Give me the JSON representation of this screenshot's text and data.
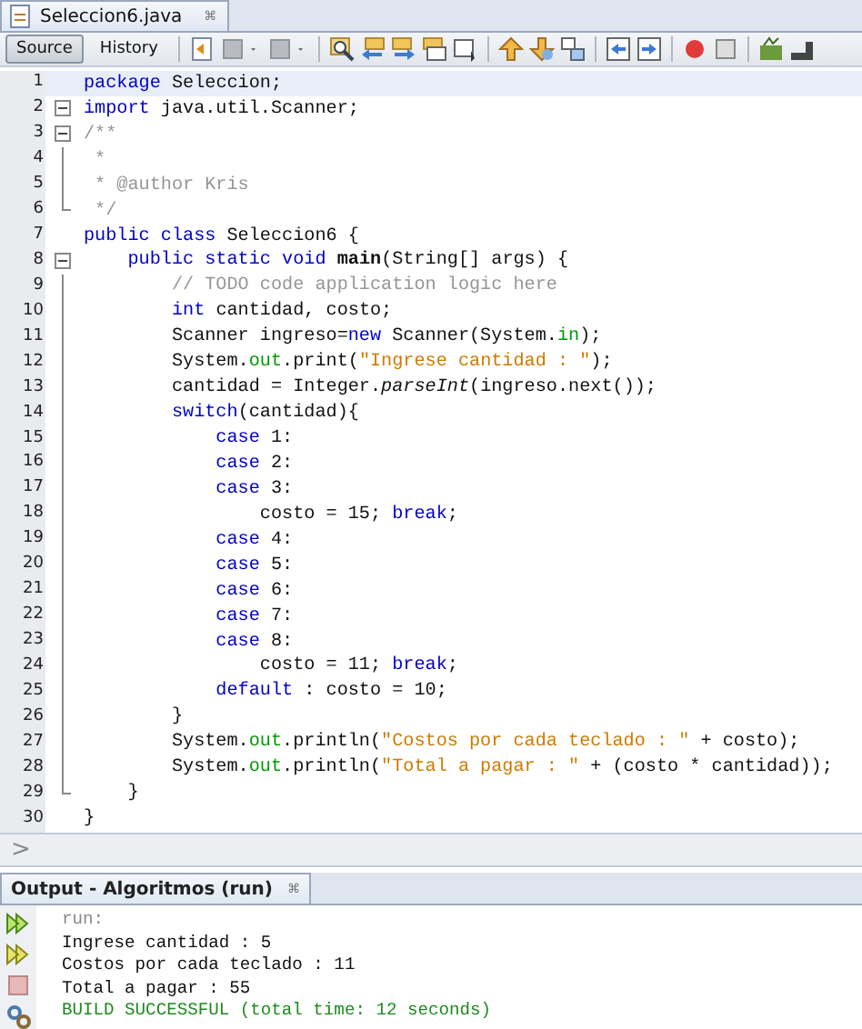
{
  "editor_tab": {
    "title": "Seleccion6.java",
    "close": "⌘"
  },
  "view_tabs": [
    {
      "label": "Source",
      "selected": true
    },
    {
      "label": "History",
      "selected": false
    }
  ],
  "code_lines": [
    {
      "number": "1",
      "current": true,
      "tokens": [
        {
          "t": "package",
          "kind": "kw"
        },
        {
          "t": " Seleccion;",
          "kind": "plain"
        }
      ]
    },
    {
      "number": "2",
      "current": false,
      "fold": {
        "kind": "start"
      },
      "tokens": [
        {
          "t": "import",
          "kind": "kw"
        },
        {
          "t": " java.util.Scanner;",
          "kind": "plain"
        }
      ]
    },
    {
      "number": "3",
      "current": false,
      "fold": {
        "kind": "start"
      },
      "tokens": [
        {
          "t": "/**",
          "kind": "comment"
        }
      ]
    },
    {
      "number": "4",
      "current": false,
      "fold": {
        "kind": "line"
      },
      "tokens": [
        {
          "t": " *",
          "kind": "comment"
        }
      ]
    },
    {
      "number": "5",
      "current": false,
      "fold": {
        "kind": "line"
      },
      "tokens": [
        {
          "t": " * @author Kris",
          "kind": "comment"
        }
      ]
    },
    {
      "number": "6",
      "current": false,
      "fold": {
        "kind": "end"
      },
      "tokens": [
        {
          "t": " */",
          "kind": "comment"
        }
      ]
    },
    {
      "number": "7",
      "current": false,
      "tokens": [
        {
          "t": "public class",
          "kind": "kw"
        },
        {
          "t": " Seleccion6 {",
          "kind": "plain"
        }
      ]
    },
    {
      "number": "8",
      "current": false,
      "fold": {
        "kind": "start"
      },
      "tokens": [
        {
          "t": "    public static void ",
          "kind": "kw"
        },
        {
          "t": "main",
          "kind": "method"
        },
        {
          "t": "(String[] args) {",
          "kind": "plain"
        }
      ]
    },
    {
      "number": "9",
      "current": false,
      "fold": {
        "kind": "line"
      },
      "tokens": [
        {
          "t": "        // TODO code application logic here",
          "kind": "comment"
        }
      ]
    },
    {
      "number": "10",
      "current": false,
      "fold": {
        "kind": "line"
      },
      "tokens": [
        {
          "t": "        int",
          "kind": "kw"
        },
        {
          "t": " cantidad, costo;",
          "kind": "plain"
        }
      ]
    },
    {
      "number": "11",
      "current": false,
      "fold": {
        "kind": "line"
      },
      "tokens": [
        {
          "t": "        Scanner ingreso=",
          "kind": "plain"
        },
        {
          "t": "new",
          "kind": "kw"
        },
        {
          "t": " Scanner(System.",
          "kind": "plain"
        },
        {
          "t": "in",
          "kind": "field"
        },
        {
          "t": ");",
          "kind": "plain"
        }
      ]
    },
    {
      "number": "12",
      "current": false,
      "fold": {
        "kind": "line"
      },
      "tokens": [
        {
          "t": "        System.",
          "kind": "plain"
        },
        {
          "t": "out",
          "kind": "field"
        },
        {
          "t": ".print(",
          "kind": "plain"
        },
        {
          "t": "\"Ingrese cantidad : \"",
          "kind": "str"
        },
        {
          "t": ");",
          "kind": "plain"
        }
      ]
    },
    {
      "number": "13",
      "current": false,
      "fold": {
        "kind": "line"
      },
      "tokens": [
        {
          "t": "        cantidad = Integer.",
          "kind": "plain"
        },
        {
          "t": "parseInt",
          "kind": "static"
        },
        {
          "t": "(ingreso.next());",
          "kind": "plain"
        }
      ]
    },
    {
      "number": "14",
      "current": false,
      "fold": {
        "kind": "line"
      },
      "tokens": [
        {
          "t": "        switch",
          "kind": "kw"
        },
        {
          "t": "(cantidad){",
          "kind": "plain"
        }
      ]
    },
    {
      "number": "15",
      "current": false,
      "fold": {
        "kind": "line"
      },
      "tokens": [
        {
          "t": "            case",
          "kind": "kw"
        },
        {
          "t": " 1:",
          "kind": "plain"
        }
      ]
    },
    {
      "number": "16",
      "current": false,
      "fold": {
        "kind": "line"
      },
      "tokens": [
        {
          "t": "            case",
          "kind": "kw"
        },
        {
          "t": " 2:",
          "kind": "plain"
        }
      ]
    },
    {
      "number": "17",
      "current": false,
      "fold": {
        "kind": "line"
      },
      "tokens": [
        {
          "t": "            case",
          "kind": "kw"
        },
        {
          "t": " 3:",
          "kind": "plain"
        }
      ]
    },
    {
      "number": "18",
      "current": false,
      "fold": {
        "kind": "line"
      },
      "tokens": [
        {
          "t": "                costo = 15; ",
          "kind": "plain"
        },
        {
          "t": "break",
          "kind": "kw"
        },
        {
          "t": ";",
          "kind": "plain"
        }
      ]
    },
    {
      "number": "19",
      "current": false,
      "fold": {
        "kind": "line"
      },
      "tokens": [
        {
          "t": "            case",
          "kind": "kw"
        },
        {
          "t": " 4:",
          "kind": "plain"
        }
      ]
    },
    {
      "number": "20",
      "current": false,
      "fold": {
        "kind": "line"
      },
      "tokens": [
        {
          "t": "            case",
          "kind": "kw"
        },
        {
          "t": " 5:",
          "kind": "plain"
        }
      ]
    },
    {
      "number": "21",
      "current": false,
      "fold": {
        "kind": "line"
      },
      "tokens": [
        {
          "t": "            case",
          "kind": "kw"
        },
        {
          "t": " 6:",
          "kind": "plain"
        }
      ]
    },
    {
      "number": "22",
      "current": false,
      "fold": {
        "kind": "line"
      },
      "tokens": [
        {
          "t": "            case",
          "kind": "kw"
        },
        {
          "t": " 7:",
          "kind": "plain"
        }
      ]
    },
    {
      "number": "23",
      "current": false,
      "fold": {
        "kind": "line"
      },
      "tokens": [
        {
          "t": "            case",
          "kind": "kw"
        },
        {
          "t": " 8:",
          "kind": "plain"
        }
      ]
    },
    {
      "number": "24",
      "current": false,
      "fold": {
        "kind": "line"
      },
      "tokens": [
        {
          "t": "                costo = 11; ",
          "kind": "plain"
        },
        {
          "t": "break",
          "kind": "kw"
        },
        {
          "t": ";",
          "kind": "plain"
        }
      ]
    },
    {
      "number": "25",
      "current": false,
      "fold": {
        "kind": "line"
      },
      "tokens": [
        {
          "t": "            default",
          "kind": "kw"
        },
        {
          "t": " : costo = 10;",
          "kind": "plain"
        }
      ]
    },
    {
      "number": "26",
      "current": false,
      "fold": {
        "kind": "line"
      },
      "tokens": [
        {
          "t": "        }",
          "kind": "plain"
        }
      ]
    },
    {
      "number": "27",
      "current": false,
      "fold": {
        "kind": "line"
      },
      "tokens": [
        {
          "t": "        System.",
          "kind": "plain"
        },
        {
          "t": "out",
          "kind": "field"
        },
        {
          "t": ".println(",
          "kind": "plain"
        },
        {
          "t": "\"Costos por cada teclado : \"",
          "kind": "str"
        },
        {
          "t": " + costo);",
          "kind": "plain"
        }
      ]
    },
    {
      "number": "28",
      "current": false,
      "fold": {
        "kind": "line"
      },
      "tokens": [
        {
          "t": "        System.",
          "kind": "plain"
        },
        {
          "t": "out",
          "kind": "field"
        },
        {
          "t": ".println(",
          "kind": "plain"
        },
        {
          "t": "\"Total a pagar : \"",
          "kind": "str"
        },
        {
          "t": " + (costo * cantidad));",
          "kind": "plain"
        }
      ]
    },
    {
      "number": "29",
      "current": false,
      "fold": {
        "kind": "end"
      },
      "tokens": [
        {
          "t": "    }",
          "kind": "plain"
        }
      ]
    },
    {
      "number": "30",
      "current": false,
      "tokens": [
        {
          "t": "}",
          "kind": "plain"
        }
      ]
    }
  ],
  "breadcrumb": {
    "arrow": ">"
  },
  "output_tab": {
    "title": "Output - Algoritmos (run)",
    "close": "⌘"
  },
  "output_lines": [
    {
      "text": "run:",
      "kind": "info"
    },
    {
      "text": "Ingrese cantidad : 5",
      "kind": "plain"
    },
    {
      "text": "Costos por cada teclado : 11",
      "kind": "plain"
    },
    {
      "text": "Total a pagar : 55",
      "kind": "plain"
    },
    {
      "text": "BUILD SUCCESSFUL (total time: 12 seconds)",
      "kind": "success"
    }
  ]
}
